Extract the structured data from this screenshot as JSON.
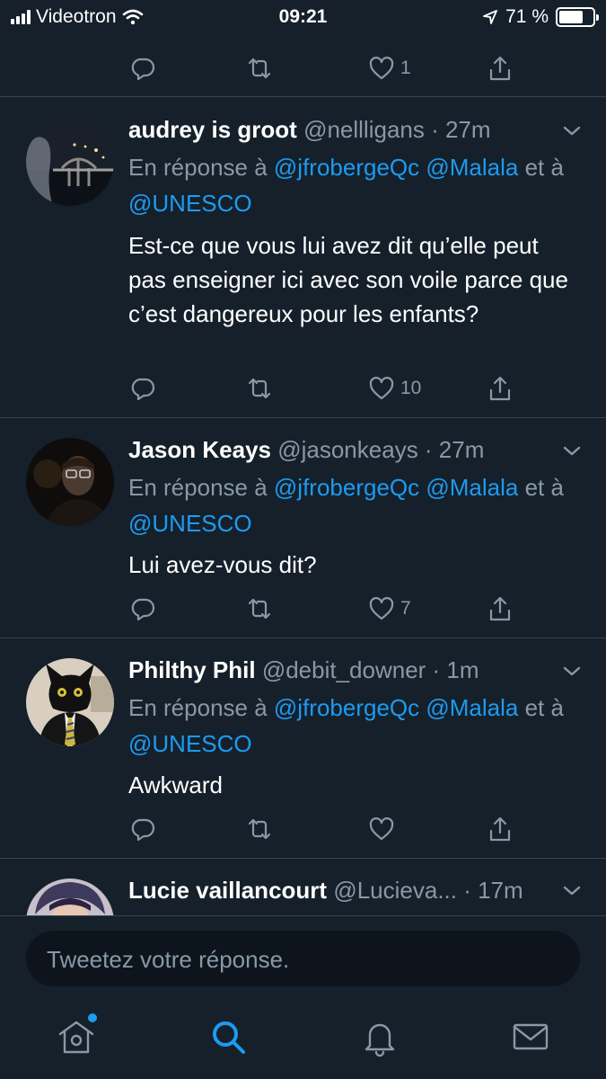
{
  "status_bar": {
    "carrier": "Videotron",
    "time": "09:21",
    "battery_pct": "71 %",
    "battery_level": 0.71
  },
  "top_tweet_actions": {
    "like_count": "1"
  },
  "tweets": [
    {
      "name": "audrey is groot",
      "meta": "@nellligans · 27m",
      "reply_prefix": "En réponse à",
      "mention1": "@jfrobergeQc",
      "mention2": "@Malala",
      "reply_join": "et à",
      "mention3": "@UNESCO",
      "body": "Est-ce que vous lui avez dit qu’elle peut pas enseigner ici avec son voile parce que c’est dangereux pour les enfants?",
      "like_count": "10"
    },
    {
      "name": "Jason Keays",
      "meta": "@jasonkeays · 27m",
      "reply_prefix": "En réponse à",
      "mention1": "@jfrobergeQc",
      "mention2": "@Malala",
      "reply_join": "et à",
      "mention3": "@UNESCO",
      "body": "Lui avez-vous dit?",
      "like_count": "7"
    },
    {
      "name": "Philthy Phil",
      "meta": "@debit_downer · 1m",
      "reply_prefix": "En réponse à",
      "mention1": "@jfrobergeQc",
      "mention2": "@Malala",
      "reply_join": "et à",
      "mention3": "@UNESCO",
      "body": "Awkward",
      "like_count": ""
    },
    {
      "name": "Lucie vaillancourt",
      "meta": "@Lucieva... · 17m"
    }
  ],
  "composer": {
    "placeholder": "Tweetez votre réponse."
  },
  "tabbar": {
    "items": [
      {
        "icon": "home-icon",
        "active": false,
        "has_badge": true
      },
      {
        "icon": "search-icon",
        "active": true
      },
      {
        "icon": "bell-icon",
        "active": false
      },
      {
        "icon": "mail-icon",
        "active": false
      }
    ]
  },
  "colors": {
    "background": "#15202b",
    "accent": "#1d9bf0",
    "secondary_text": "#8899a6",
    "divider": "#38444d"
  }
}
